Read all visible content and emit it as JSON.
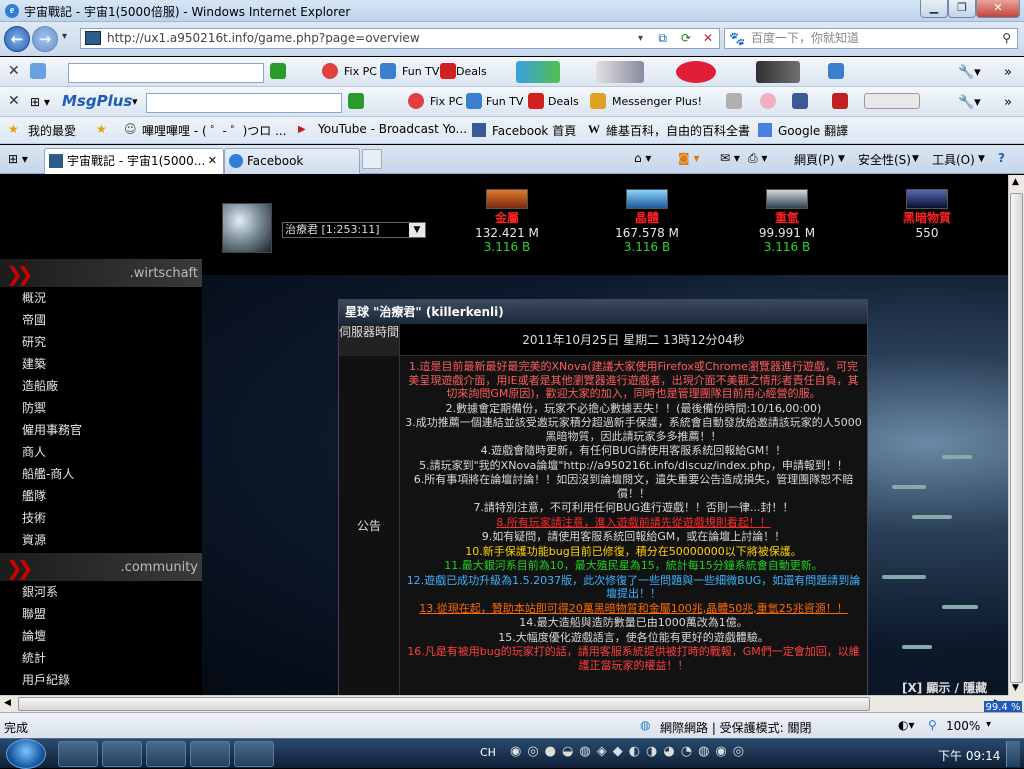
{
  "window": {
    "title": "宇宙戰記 - 宇宙1(5000倍服) - Windows Internet Explorer"
  },
  "address": {
    "url": "http://ux1.a950216t.info/game.php?page=overview",
    "search_placeholder": "百度一下，你就知道"
  },
  "toolbar1": {
    "items": [
      "Fix PC",
      "Fun TV",
      "Deals"
    ]
  },
  "toolbar2": {
    "brand": "MsgPlus",
    "items": [
      "Fix PC",
      "Fun TV",
      "Deals",
      "Messenger Plus!"
    ]
  },
  "favorites": {
    "label": "我的最愛",
    "items": [
      "嗶哩嗶哩 - ( ゜- ゜)つロ ...",
      "YouTube - Broadcast Yo...",
      "Facebook 首頁",
      "維基百科，自由的百科全書",
      "Google 翻譯"
    ]
  },
  "tabs": [
    {
      "label": "宇宙戰記 - 宇宙1(5000...",
      "active": true
    },
    {
      "label": "Facebook",
      "active": false
    }
  ],
  "commandbar": {
    "page": "網頁(P)",
    "safety": "安全性(S)",
    "tools": "工具(O)"
  },
  "game": {
    "planet_select": "治療君 [1:253:11]",
    "resources": [
      {
        "name": "金屬",
        "value": "132.421 M",
        "rate": "3.116 B",
        "icon_color": "#c05020"
      },
      {
        "name": "晶體",
        "value": "167.578 M",
        "rate": "3.116 B",
        "icon_color": "#40a0e0"
      },
      {
        "name": "重氫",
        "value": "99.991 M",
        "rate": "3.116 B",
        "icon_color": "#a0b0c0"
      },
      {
        "name": "黑暗物質",
        "value": "550",
        "rate": "",
        "icon_color": "#203060"
      }
    ],
    "sections": [
      {
        "label": ".wirtschaft",
        "items": [
          "概況",
          "帝國",
          "研究",
          "建築",
          "造船廠",
          "防禦",
          "僱用事務官",
          "商人",
          "船艦-商人",
          "艦隊",
          "技術",
          "資源"
        ]
      },
      {
        "label": ".community",
        "items": [
          "銀河系",
          "聯盟",
          "論壇",
          "統計",
          "用戶紀錄"
        ]
      }
    ],
    "panel": {
      "title": "星球 \"治療君\" (killerkenli)",
      "server_time_label": "伺服器時間",
      "server_time": "2011年10月25日 星期二 13時12分04秒",
      "announce_label": "公告",
      "announcements": [
        {
          "text": "1.這是目前最新最好最完美的XNova(建議大家使用Firefox或Chrome瀏覽器進行遊戲，可完美呈現遊戲介面，用IE或者是其他瀏覽器進行遊戲者，出現介面不美觀之情形者責任自負，其切來詢問GM原因)，歡迎大家的加入，同時也是管理團隊目前用心經營的服。",
          "color": "#ff5c5c"
        },
        {
          "text": "2.數據會定期備份，玩家不必擔心數據丟失！！(最後備份時間:10/16,00:00)",
          "color": "#d8d8d8"
        },
        {
          "text": "3.成功推薦一個連結並該受邀玩家積分超過新手保護，系統會自動發放給邀請該玩家的人5000黑暗物質，因此請玩家多多推薦！！",
          "color": "#d8d8d8"
        },
        {
          "text": "4.遊戲會隨時更新，有任何BUG請使用客服系統回報給GM！！",
          "color": "#d8d8d8"
        },
        {
          "text": "5.請玩家到\"我的XNova論壇\"http://a950216t.info/discuz/index.php，申請報到！！",
          "color": "#d8d8d8"
        },
        {
          "text": "6.所有事項將在論壇討論！！如因沒到論壇閱文，遺失重要公告造成損失，管理團隊恕不賠償！！",
          "color": "#d8d8d8"
        },
        {
          "text": "7.請特別注意，不可利用任何BUG進行遊戲！！否則一律...封！！",
          "color": "#d8d8d8"
        },
        {
          "text": "8.所有玩家請注意，進入遊戲前請先從遊戲規則看起！！",
          "color": "#ff2a2a"
        },
        {
          "text": "9.如有疑問，請使用客服系統回報給GM，或在論壇上討論！！",
          "color": "#d8d8d8"
        },
        {
          "text": "10.新手保護功能bug目前已修復，積分在50000000以下將被保護。",
          "color": "#ffd200"
        },
        {
          "text": "11.最大銀河系目前為10，最大殖民星為15，統計每15分鐘系統會自動更新。",
          "color": "#20d020"
        },
        {
          "text": "12.遊戲已成功升級為1.5.2037版，此次修復了一些問題與一些細微BUG，如還有問題請到論壇提出！！",
          "color": "#3ab4ff"
        },
        {
          "text": "13.從現在起，贊助本站即可得20萬黑暗物質和金屬100兆,晶體50兆,重氫25兆資源！！",
          "color": "#ff6a00"
        },
        {
          "text": "14.最大造船與造防數量已由1000萬改為1億。",
          "color": "#d8d8d8"
        },
        {
          "text": "15.大幅度優化遊戲語言，使各位能有更好的遊戲體驗。",
          "color": "#d8d8d8"
        },
        {
          "text": "16.凡是有被用bug的玩家打的話，請用客服系統提供被打時的戰報，GM們一定會加回，以維護正當玩家的權益！！",
          "color": "#ff4040"
        }
      ]
    },
    "toggle": "[X] 顯示 / 隱藏"
  },
  "status": {
    "left": "完成",
    "zone": "網際網路 | 受保護模式: 關閉",
    "zoom": "100%",
    "zoom_badge": "99.4 %"
  },
  "taskbar": {
    "lang": "CH",
    "time": "下午 09:14"
  }
}
